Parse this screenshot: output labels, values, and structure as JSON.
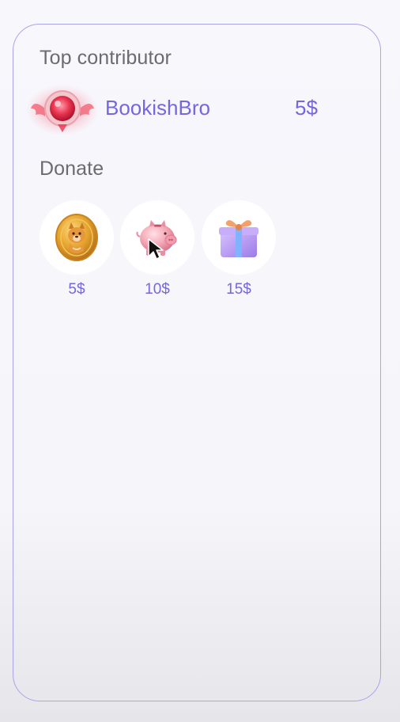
{
  "top_contributor": {
    "heading": "Top contributor",
    "name": "BookishBro",
    "amount": "5$",
    "badge_icon": "winged-ruby-badge-icon"
  },
  "donate": {
    "heading": "Donate",
    "options": [
      {
        "label": "5$",
        "icon": "dog-coin-icon"
      },
      {
        "label": "10$",
        "icon": "piggy-bank-icon"
      },
      {
        "label": "15$",
        "icon": "gift-box-icon"
      }
    ]
  },
  "colors": {
    "accent": "#7567dd",
    "border": "#a9a3ea",
    "heading": "#6b6b70",
    "background": "#f7f7fc"
  }
}
